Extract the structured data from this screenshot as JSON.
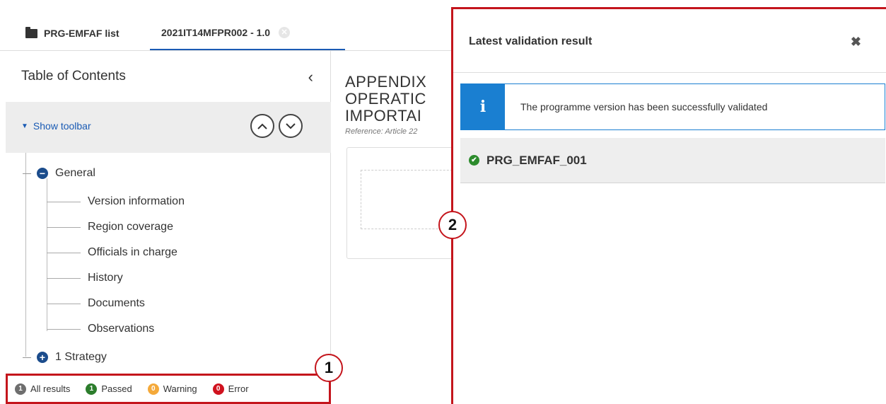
{
  "tabs": [
    {
      "label": "PRG-EMFAF list"
    },
    {
      "label": "2021IT14MFPR002 - 1.0"
    }
  ],
  "sidebar": {
    "title": "Table of Contents",
    "show_toolbar": "Show toolbar",
    "general": "General",
    "items": [
      "Version information",
      "Region coverage",
      "Officials in charge",
      "History",
      "Documents",
      "Observations"
    ],
    "strategy": "1 Strategy"
  },
  "filters": [
    {
      "count": "1",
      "label": "All results"
    },
    {
      "count": "1",
      "label": "Passed"
    },
    {
      "count": "0",
      "label": "Warning"
    },
    {
      "count": "0",
      "label": "Error"
    }
  ],
  "markers": [
    "1",
    "2"
  ],
  "main": {
    "title_lines": [
      "APPENDIX",
      "OPERATIC",
      "IMPORTAI"
    ],
    "reference": "Reference: Article 22"
  },
  "panel": {
    "title": "Latest validation result",
    "info": "The programme version has been successfully validated",
    "result": "PRG_EMFAF_001"
  },
  "colors": {
    "accent": "#1a5bb4",
    "highlight": "#c4151c",
    "info": "#1a7fd1",
    "passed": "#2c7d2c",
    "warning": "#f4a93a",
    "error": "#d0121e"
  }
}
